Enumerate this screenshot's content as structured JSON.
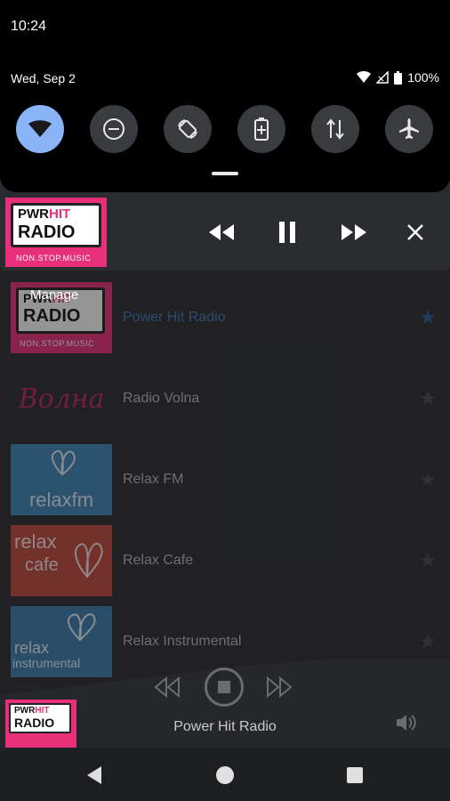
{
  "status_bar": {
    "time": "10:24",
    "date": "Wed, Sep 2",
    "battery": "100%"
  },
  "quick_settings": [
    {
      "name": "wifi",
      "active": true
    },
    {
      "name": "do-not-disturb",
      "active": false
    },
    {
      "name": "auto-rotate",
      "active": false
    },
    {
      "name": "battery-saver",
      "active": false
    },
    {
      "name": "mobile-data",
      "active": false
    },
    {
      "name": "airplane-mode",
      "active": false
    }
  ],
  "media_notification": {
    "logo_top": "PWR",
    "logo_top2": "HIT",
    "logo_main": "RADIO",
    "logo_tag": "NON.STOP.MUSIC"
  },
  "manage_label": "Manage",
  "stations": [
    {
      "label": "Power Hit Radio",
      "highlight": true
    },
    {
      "label": "Radio Volna",
      "highlight": false,
      "logo": "Волна"
    },
    {
      "label": "Relax FM",
      "highlight": false,
      "logo": "relaxfm"
    },
    {
      "label": "Relax Cafe",
      "highlight": false,
      "logo_line1": "relax",
      "logo_line2": "cafe"
    },
    {
      "label": "Relax Instrumental",
      "highlight": false,
      "logo_line1": "relax",
      "logo_line2": "instrumental"
    }
  ],
  "player": {
    "title": "Power Hit Radio"
  },
  "colors": {
    "accent": "#8ab4f8",
    "pink": "#e8307a",
    "relax_blue": "#3f86b8",
    "relax_red": "#c44a3c",
    "highlight_text": "#3a79b8"
  }
}
